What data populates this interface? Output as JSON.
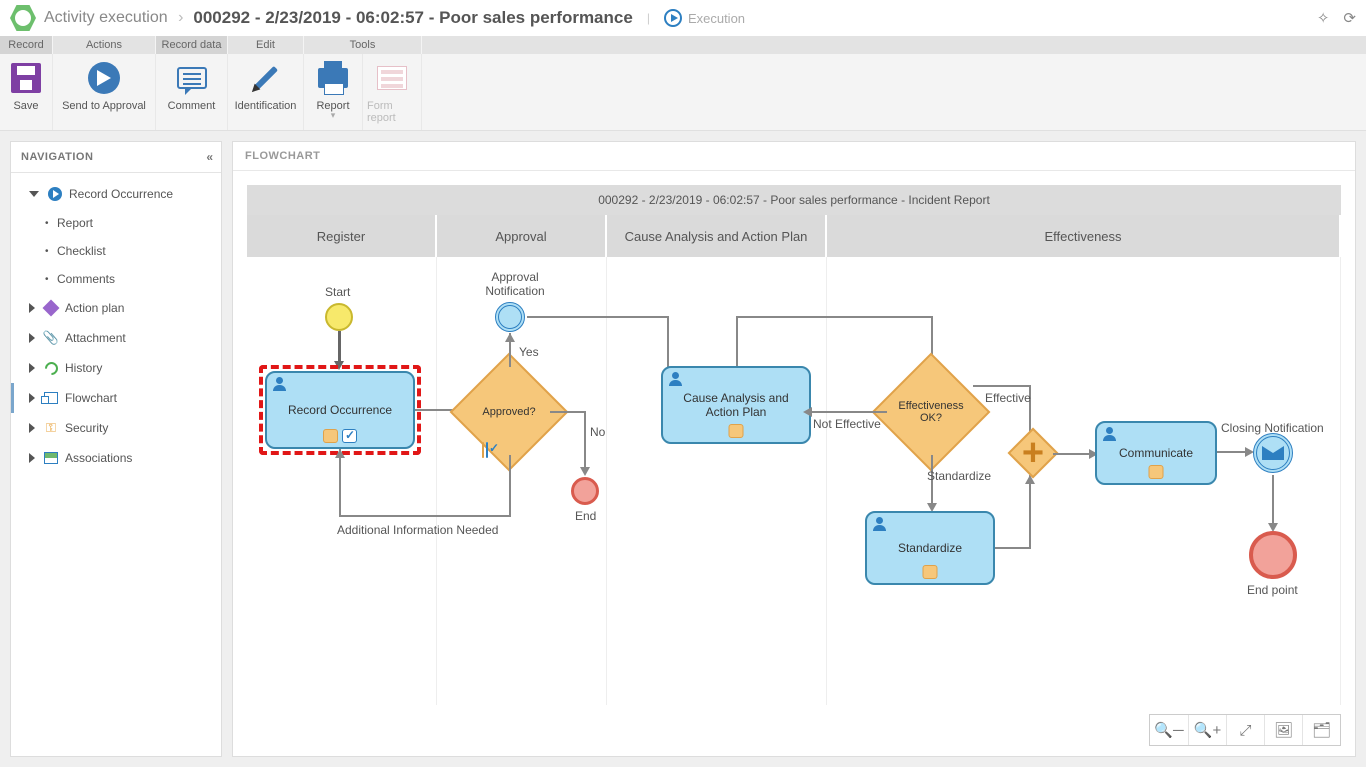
{
  "title": {
    "breadcrumb": "Activity execution",
    "record": "000292 - 2/23/2019 - 06:02:57 - Poor sales performance",
    "mode": "Execution"
  },
  "ribbon": {
    "groups": {
      "record": "Record",
      "actions": "Actions",
      "rdata": "Record data",
      "edit": "Edit",
      "tools": "Tools"
    },
    "buttons": {
      "save": "Save",
      "send": "Send to Approval",
      "comment": "Comment",
      "ident": "Identification",
      "report": "Report",
      "form": "Form report"
    }
  },
  "sidebar": {
    "header": "NAVIGATION",
    "items": {
      "record_occurrence": "Record Occurrence",
      "report": "Report",
      "checklist": "Checklist",
      "comments": "Comments",
      "action_plan": "Action plan",
      "attachment": "Attachment",
      "history": "History",
      "flowchart": "Flowchart",
      "security": "Security",
      "associations": "Associations"
    }
  },
  "flow": {
    "panel_header": "FLOWCHART",
    "title": "000292 - 2/23/2019 - 06:02:57 - Poor sales performance - Incident Report",
    "lanes": {
      "register": "Register",
      "approval": "Approval",
      "cause": "Cause Analysis and Action Plan",
      "effectiveness": "Effectiveness"
    },
    "nodes": {
      "start": "Start",
      "record_occurrence": "Record Occurrence",
      "approved_gw": "Approved?",
      "approval_notif": "Approval Notification",
      "yes": "Yes",
      "no": "No",
      "end": "End",
      "additional_info": "Additional Information Needed",
      "cause_task": "Cause Analysis and Action Plan",
      "eff_gw": "Effectiveness OK?",
      "not_effective": "Not Effective",
      "effective": "Effective",
      "standardize_lbl": "Standardize",
      "standardize_task": "Standardize",
      "communicate": "Communicate",
      "closing_notif": "Closing Notification",
      "end_point": "End point"
    },
    "zoom_icons": {
      "out": "zoom-out",
      "in": "zoom-in",
      "fit": "fit",
      "image": "image",
      "tree": "tree"
    }
  }
}
